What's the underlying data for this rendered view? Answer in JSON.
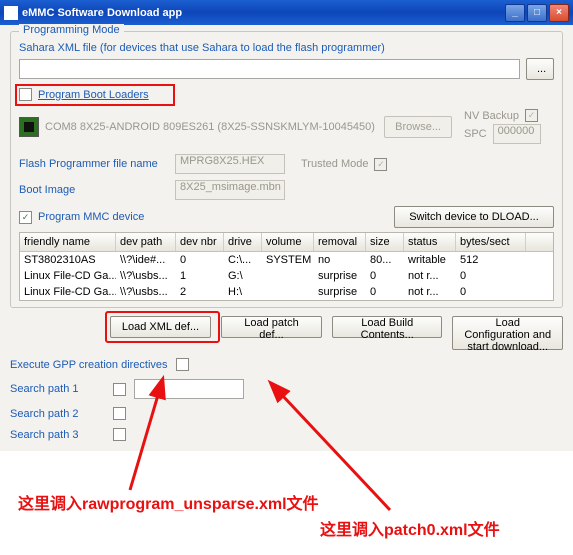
{
  "window": {
    "title": "eMMC Software Download app"
  },
  "group": {
    "title": "Programming Mode"
  },
  "sahara": {
    "label": "Sahara XML file (for devices that use Sahara to load the flash programmer)",
    "browse": "..."
  },
  "boot": {
    "chk_label": "Program Boot Loaders",
    "device": "COM8  8X25-ANDROID  809ES261 (8X25-SSNSKMLYM-10045450)",
    "browse": "Browse...",
    "nv": "NV Backup",
    "spc": "SPC",
    "spc_val": "000000"
  },
  "fp": {
    "label": "Flash Programmer file name",
    "val": "MPRG8X25.HEX",
    "trusted": "Trusted Mode"
  },
  "bi": {
    "label": "Boot Image",
    "val": "8X25_msimage.mbn"
  },
  "mmc": {
    "chk": "Program MMC device",
    "switch": "Switch device to DLOAD..."
  },
  "cols": [
    "friendly name",
    "dev path",
    "dev nbr",
    "drive",
    "volume",
    "removal",
    "size",
    "status",
    "bytes/sect"
  ],
  "rows": [
    {
      "c": [
        "ST3802310AS",
        "\\\\?\\ide#...",
        "0",
        "C:\\...",
        "SYSTEM",
        "no",
        "80...",
        "writable",
        "512"
      ]
    },
    {
      "c": [
        "Linux File-CD Ga...",
        "\\\\?\\usbs...",
        "1",
        "G:\\",
        "",
        "surprise",
        "0",
        "not r...",
        "0"
      ]
    },
    {
      "c": [
        "Linux File-CD Ga...",
        "\\\\?\\usbs...",
        "2",
        "H:\\",
        "",
        "surprise",
        "0",
        "not r...",
        "0"
      ]
    }
  ],
  "btns": {
    "xml": "Load XML def...",
    "patch": "Load patch def...",
    "build": "Load Build Contents...",
    "conf": "Load Configuration and start download..."
  },
  "gpp": "Execute GPP creation directives",
  "sp1": "Search path 1",
  "sp2": "Search path 2",
  "sp3": "Search path 3",
  "anno1": "这里调入rawprogram_unsparse.xml文件",
  "anno2": "这里调入patch0.xml文件"
}
